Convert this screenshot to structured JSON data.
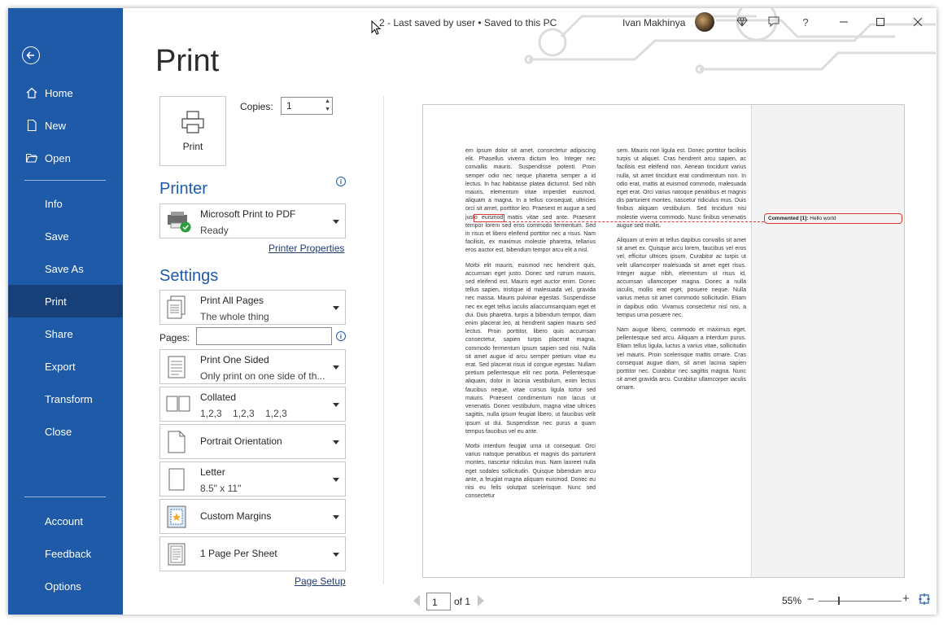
{
  "titlebar": {
    "doc_title": "2  -  Last saved by user  •  Saved to this PC",
    "user_name": "Ivan Makhinya",
    "help": "?"
  },
  "sidebar": {
    "top_items": [
      {
        "label": "Home",
        "icon": "home-icon"
      },
      {
        "label": "New",
        "icon": "new-document-icon"
      },
      {
        "label": "Open",
        "icon": "folder-open-icon"
      }
    ],
    "mid_items": [
      "Info",
      "Save",
      "Save As",
      "Print",
      "Share",
      "Export",
      "Transform",
      "Close"
    ],
    "active": "Print",
    "bottom_items": [
      "Account",
      "Feedback",
      "Options"
    ]
  },
  "main": {
    "heading": "Print",
    "print_button_label": "Print",
    "copies_label": "Copies:",
    "copies_value": "1",
    "printer_heading": "Printer",
    "printer": {
      "name": "Microsoft Print to PDF",
      "status": "Ready"
    },
    "printer_properties_link": "Printer Properties",
    "settings_heading": "Settings",
    "settings": [
      {
        "line1": "Print All Pages",
        "line2": "The whole thing",
        "icon": "pages-icon"
      },
      {
        "line1": "Print One Sided",
        "line2": "Only print on one side of th...",
        "icon": "one-sided-icon"
      },
      {
        "line1": "Collated",
        "line2": "1,2,3    1,2,3    1,2,3",
        "icon": "collated-icon"
      },
      {
        "line1": "Portrait Orientation",
        "line2": "",
        "icon": "portrait-icon"
      },
      {
        "line1": "Letter",
        "line2": "8.5\" x 11\"",
        "icon": "paper-size-icon"
      },
      {
        "line1": "Custom Margins",
        "line2": "",
        "icon": "margins-icon"
      },
      {
        "line1": "1 Page Per Sheet",
        "line2": "",
        "icon": "pages-per-sheet-icon"
      }
    ],
    "pages_label": "Pages:",
    "pages_value": "",
    "page_setup_link": "Page Setup"
  },
  "preview": {
    "col1": [
      "em ipsum dolor sit amet, consectetur adipiscing elit. Phasellus viverra dictum leo. Integer nec convallis mauris. Suspendisse potenti. Proin semper odio nec neque pharetra semper a id lectus. In hac habitasse platea dictumst. Sed nibh mauris, elementum vitae imperdiet euismod, aliquam a magna. In a tellus consequat, ultricies orci sit amet, porttitor leo. Praesent et augue a sed justo euismod mattis vitae sed ante. Praesent tempor lorem sed eros commodo fermentum. Sed in risus et libero eleifend porttitor nec a risus. Nam facilisis, ex maximus molestie pharetra, tellarius eros auctor est, bibendum tempor arcu elit a nisl.",
      "Morbi elit mauris, euismod nec hendrerit quis, accumsan eget justo. Donec sed rutrum mauris, sed eleifend est. Mauris eget auctor enim. Donec tellus sapien, tristique id malesuada vel, gravida nec massa. Mauris pulvinar egestas. Suspendisse nec ex eget tellus iaculis aliaccumsanquam eget et dui. Duis pharetra, turpis a bibendum tempor, diam enim placerat leo, at hendrerit sapien mauris sed lectus. Proin porttitor, libero quis accumsan consectetur, sapien turpis placerat magna, commodo fermentum ipsum sapien sed nisi. Nulla sit amet augue id arcu semper pretium vitae eu erat. Sed placerat risus id congue egestas. Nullam pretium pellentesque elit nec porta. Pellentesque aliquam, dolor in lacinia vestibulum, enim lectus faucibus neque, vitae cursus ligula tortor sed mauris. Praesent condimentum non lacus ut venenatis. Donec vestibulum, magna vitae ultrices sagittis, nulla ipsum feugiat libero, ut faucibus velit ipsum ut dui. Suspendisse nec purus a quam tempus faucibus vel eu ante.",
      "Morbi interdum feugiat urna ut consequat. Orci varius natoque penatibus et magnis dis parturient montes, nascetur ridiculus mus. Nam laoreet nulla eget sodales sollicitudin. Quisque bibendum arcu ante, a feugiat magna aliquam euismod. Donec eu nisi eu felis volutpat scelerisque. Nunc sed consectetur"
    ],
    "col2": [
      "sem. Mauris non ligula est. Donec porttitor facilisis turpis ut aliquet. Cras hendrerit arcu sapien, ac facilisis est eleifend non. Aenean tincidunt varius nulla, sit amet tincidunt erat condimentum non. In odio erat, mattis at euismod commodo, malesuada eget erat. Orci varius natoque penatibus et magnis dis parturient montes, nascetur ridiculus mus. Duis finibus aliquam vestibulum. Sed tincidunt nisi molestie viverra commodo. Nunc finibus venenatis augue sed mollis.",
      "Aliquam ut enim at tellus dapibus convallis sit amet sit amet ex. Quisque arcu lorem, faucibus vel eros vel, efficitur ultrices ipsum. Curabitur ac turpis ut velit ullamcorper malesuada sit amet eget risus. Integer augue nibh, elementum ut risus id, accumsan ullamcorper magna. Donec a nulla iaculis, mollis erat eget, posuere neque. Nulla varius metus sit amet commodo sollicitudin. Etiam in dapibus odio. Vivamus consectetur nisl nisi, a tempus urna posuere nec.",
      "Nam augue libero, commodo et maximus eget, pellentesque sed arcu. Aliquam a interdum purus. Etiam tellus ligula, luctus a varius vitae, sollicitudin vel mauris. Proin scelerisque mattis ornare. Cras consequat augue diam, sit amet lacinia sapien porttitor nec. Curabitur nec sagittis magna. Nunc sit amet gravida arcu. Curabitur ullamcorper iaculis ornare."
    ],
    "comment_label": "Commented [1]:",
    "comment_text": "Hello world"
  },
  "footer": {
    "page_value": "1",
    "of_text": "of 1",
    "zoom": "55%",
    "minus": "−",
    "plus": "+",
    "zoom_level": 0.55
  },
  "colors": {
    "accent": "#1e5aa8",
    "active": "#173f78",
    "comment": "#d83b3b"
  }
}
